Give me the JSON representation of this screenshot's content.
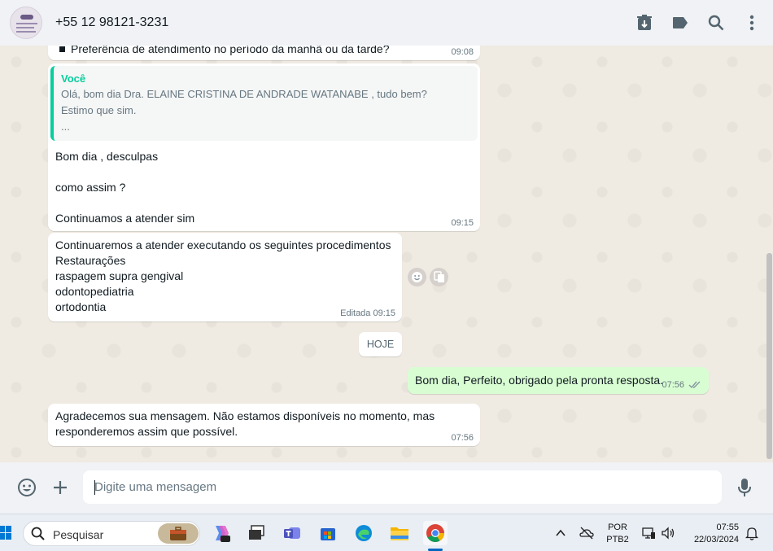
{
  "header": {
    "contact_name": "+55 12 98121-3231",
    "icons": [
      "archive-icon",
      "label-icon",
      "search-icon",
      "more-vertical-icon"
    ]
  },
  "messages": {
    "partial_top": {
      "text": "Preferência de atendimento no período da manhã ou da tarde?",
      "time": "09:08"
    },
    "reply_message": {
      "quote_author": "Você",
      "quote_lines": [
        "Olá, bom dia Dra. ELAINE CRISTINA DE ANDRADE WATANABE , tudo bem?",
        "Estimo que sim.",
        "..."
      ],
      "lines": [
        "Bom dia , desculpas",
        "como assim ?",
        "Continuamos a atender sim"
      ],
      "time": "09:15"
    },
    "procedures_message": {
      "lines": [
        "Continuaremos a atender executando os seguintes procedimentos",
        "Restaurações",
        "raspagem supra gengival",
        "odontopediatria",
        "ortodontia"
      ],
      "edited_label": "Editada 09:15"
    },
    "date_divider": "HOJE",
    "outgoing_message": {
      "text": "Bom dia, Perfeito, obrigado pela pronta resposta.",
      "time": "07:56"
    },
    "auto_reply": {
      "lines": [
        "Agradecemos sua mensagem. Não estamos disponíveis no momento, mas",
        "responderemos assim que possível."
      ],
      "time": "07:56"
    }
  },
  "composer": {
    "placeholder": "Digite uma mensagem",
    "value": ""
  },
  "taskbar": {
    "search_placeholder": "Pesquisar",
    "language_line1": "POR",
    "language_line2": "PTB2",
    "time": "07:55",
    "date": "22/03/2024"
  },
  "colors": {
    "accent_green": "#06cf9c",
    "outgoing_bubble": "#d9fdd3",
    "chat_background": "#efeae2",
    "header_background": "#f0f2f5"
  }
}
